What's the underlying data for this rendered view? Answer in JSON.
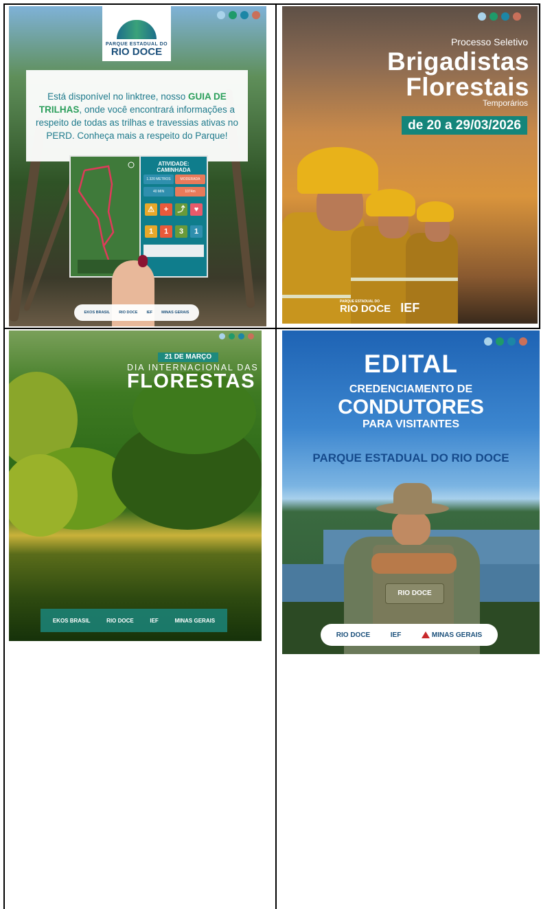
{
  "dot_colors": [
    "#a9d3ea",
    "#1f9a6a",
    "#1c86a6",
    "#c9705a"
  ],
  "card1": {
    "logo_small": "PARQUE ESTADUAL DO",
    "logo_big": "RIO DOCE",
    "text_before": "Está disponível no linktree, nosso ",
    "text_bold": "GUIA DE TRILHAS",
    "text_after": ", onde você encontrará informações a respeito de todas as trilhas e travessias ativas no PERD. Conheça mais a respeito do Parque!",
    "panel_title": "ATIVIDADE: CAMINHADA",
    "panel_cells": [
      "1.320 METROS",
      "MODERADA",
      "40 MIN",
      "1074m"
    ],
    "panel_numbers": [
      "1",
      "1",
      "3",
      "1"
    ],
    "footer": [
      "EKOS BRASIL",
      "RIO DOCE",
      "IEF",
      "MINAS GERAIS"
    ]
  },
  "card2": {
    "processo": "Processo Seletivo",
    "brigadistas": "Brigadistas",
    "florestais": "Florestais",
    "temporarios": "Temporários",
    "date": "de 20 a 29/03/2026",
    "footer_small": "PARQUE ESTADUAL DO",
    "footer_big": "RIO DOCE",
    "footer_ief": "IEF"
  },
  "card3": {
    "date_badge": "21 DE MARÇO",
    "dia": "DIA INTERNACIONAL DAS",
    "florestas": "FLORESTAS",
    "footer": [
      "EKOS BRASIL",
      "RIO DOCE",
      "IEF",
      "MINAS GERAIS"
    ]
  },
  "card4": {
    "edital": "EDITAL",
    "credenciamento": "CREDENCIAMENTO DE",
    "condutores": "CONDUTORES",
    "visitantes": "PARA VISITANTES",
    "parque": "PARQUE ESTADUAL DO RIO DOCE",
    "pack_label": "RIO DOCE",
    "footer": [
      "RIO DOCE",
      "IEF",
      "MINAS GERAIS"
    ]
  }
}
